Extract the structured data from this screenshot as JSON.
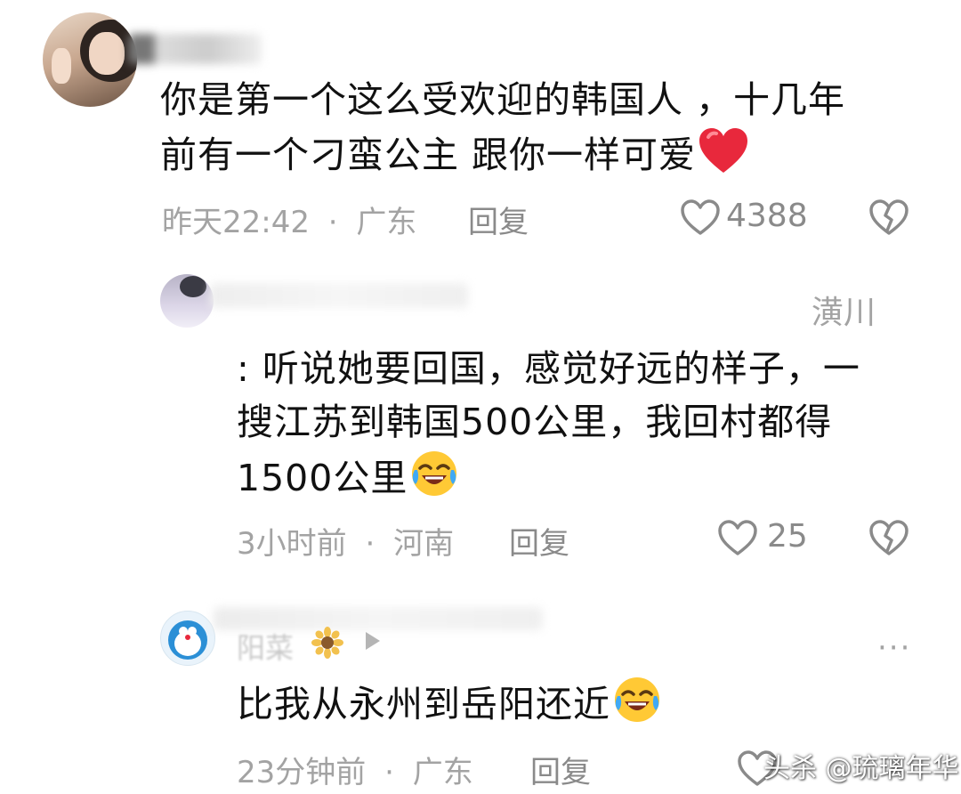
{
  "comments": [
    {
      "text_line1": "你是第一个这么受欢迎的韩国人 ，十几年",
      "text_line2": "前有一个刁蛮公主  跟你一样可爱",
      "time": "昨天22:42",
      "sep": "·",
      "location": "广东",
      "reply": "回复",
      "likes": "4388",
      "emoji": "heart"
    },
    {
      "tag": "潢川",
      "text_line1": ": 听说她要回国，感觉好远的样子，一",
      "text_line2": "搜江苏到韩国500公里，我回村都得",
      "text_line3": "1500公里",
      "time": "3小时前",
      "sep": "·",
      "location": "河南",
      "reply": "回复",
      "likes": "25",
      "emoji": "laughing-crying"
    },
    {
      "name": "阳菜",
      "more": "···",
      "text_line1": "比我从永州到岳阳还近",
      "time": "23分钟前",
      "sep": "·",
      "location": "广东",
      "reply": "回复",
      "emoji": "laughing-crying"
    }
  ],
  "watermark": "头杀 @琉璃年华",
  "colors": {
    "meta": "#a3a3a3",
    "heart": "#e8283c",
    "icon": "#8a8a8a"
  }
}
